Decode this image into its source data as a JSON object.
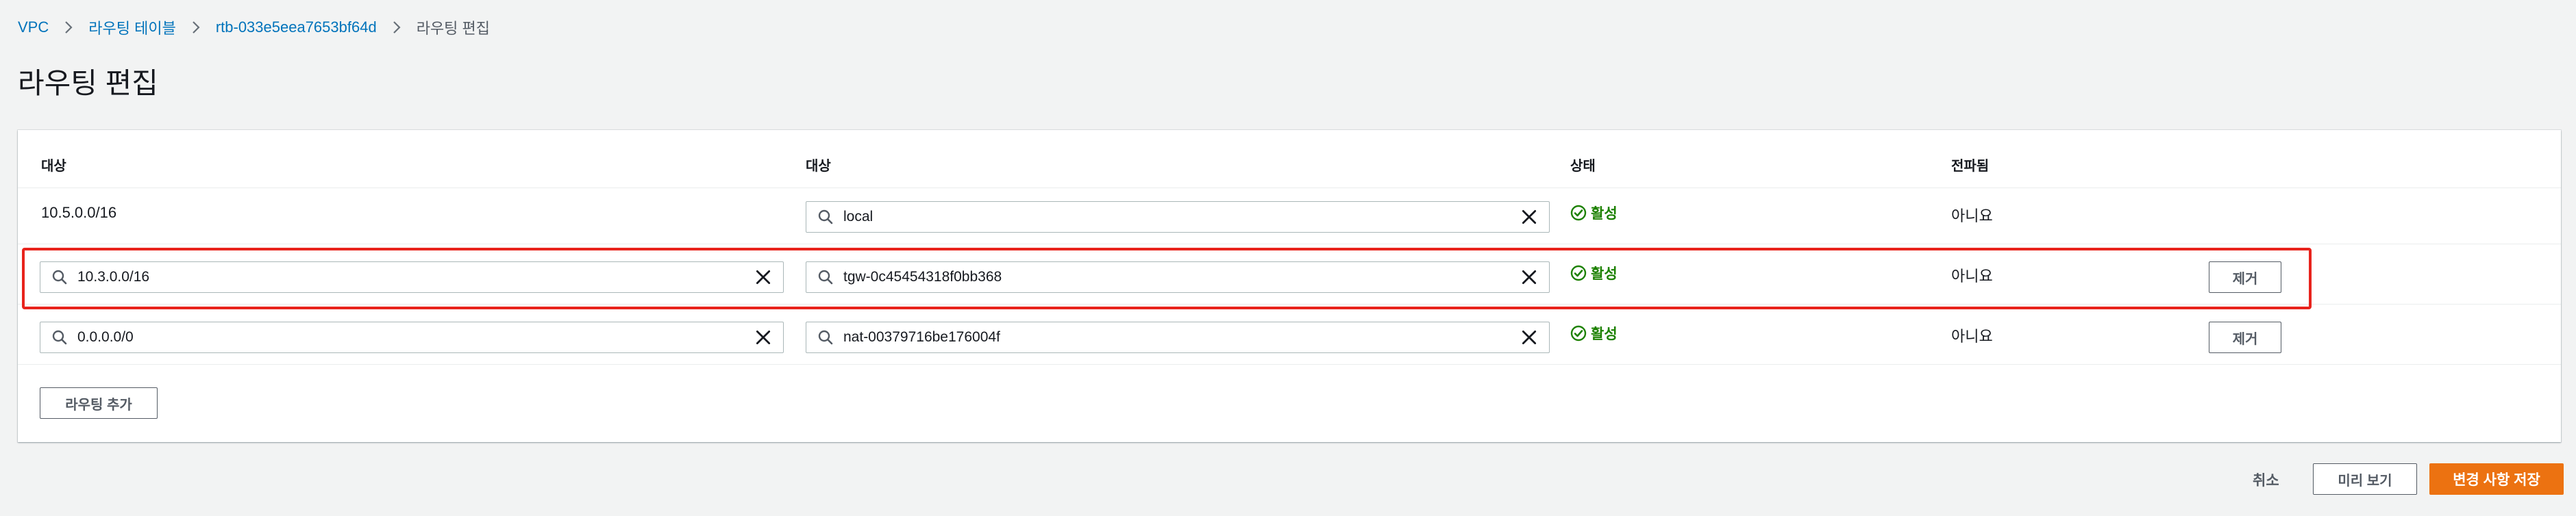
{
  "breadcrumb": {
    "items": [
      "VPC",
      "라우팅 테이블",
      "rtb-033e5eea7653bf64d"
    ],
    "current": "라우팅 편집"
  },
  "page": {
    "title": "라우팅 편집"
  },
  "table": {
    "headers": [
      "대상",
      "대상",
      "상태",
      "전파됨"
    ],
    "rows": [
      {
        "destination": "10.5.0.0/16",
        "target": "local",
        "status": "활성",
        "propagated": "아니요",
        "remove_label": ""
      },
      {
        "destination": "10.3.0.0/16",
        "target": "tgw-0c45454318f0bb368",
        "status": "활성",
        "propagated": "아니요",
        "remove_label": "제거"
      },
      {
        "destination": "0.0.0.0/0",
        "target": "nat-00379716be176004f",
        "status": "활성",
        "propagated": "아니요",
        "remove_label": "제거"
      }
    ],
    "add_route_label": "라우팅 추가"
  },
  "footer": {
    "cancel_label": "취소",
    "preview_label": "미리 보기",
    "save_label": "변경 사항 저장"
  },
  "colors": {
    "link": "#0073bb",
    "status_active": "#1d8102",
    "primary": "#ec7211",
    "highlight": "#e8231c"
  }
}
